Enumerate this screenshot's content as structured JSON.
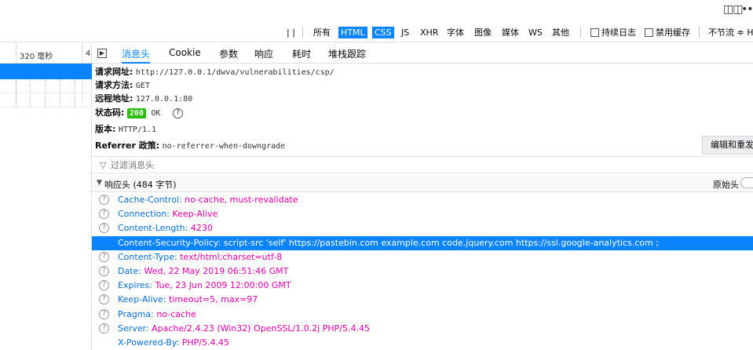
{
  "window": {
    "icon_glyph": "◫◫",
    "more_glyph": "••"
  },
  "filters": {
    "all": "所有",
    "html": "HTML",
    "css": "CSS",
    "js": "JS",
    "xhr": "XHR",
    "fonts": "字体",
    "images": "图像",
    "media": "媒体",
    "ws": "WS",
    "other": "其他"
  },
  "options": {
    "persist_logs": "持续日志",
    "disable_cache": "禁用缓存",
    "throttle": "不节流 ≑ H"
  },
  "timeline": {
    "ms_label": "320 毫秒",
    "ms_label2": "4"
  },
  "tabs": [
    "消息头",
    "Cookie",
    "参数",
    "响应",
    "耗时",
    "堆栈跟踪"
  ],
  "summary": {
    "url_label": "请求网址:",
    "url": "http://127.0.0.1/dwva/vulnerabilities/csp/",
    "method_label": "请求方法:",
    "method": "GET",
    "remote_label": "远程地址:",
    "remote": "127.0.0.1:80",
    "status_label": "状态码:",
    "status_code": "200",
    "status_text": "OK",
    "version_label": "版本:",
    "version": "HTTP/1.1",
    "referrer_label": "Referrer 政策:",
    "referrer": "no-referrer-when-downgrade"
  },
  "edit_button": "编辑和重发",
  "filter_placeholder": "过滤消息头",
  "response_headers": {
    "title": "响应头 (484 字节)",
    "raw_label": "原始头",
    "rows": [
      {
        "name": "Cache-Control:",
        "value": "no-cache, must-revalidate"
      },
      {
        "name": "Connection:",
        "value": "Keep-Alive"
      },
      {
        "name": "Content-Length:",
        "value": "4230"
      },
      {
        "name": "Content-Security-Policy:",
        "value": "script-src 'self' https://pastebin.com  example.com code.jquery.com https://ssl.google-analytics.com ;"
      },
      {
        "name": "Content-Type:",
        "value": "text/html;charset=utf-8"
      },
      {
        "name": "Date:",
        "value": "Wed, 22 May 2019 06:51:46 GMT"
      },
      {
        "name": "Expires:",
        "value": "Tue, 23 Jun 2009 12:00:00 GMT"
      },
      {
        "name": "Keep-Alive:",
        "value": "timeout=5, max=97"
      },
      {
        "name": "Pragma:",
        "value": "no-cache"
      },
      {
        "name": "Server:",
        "value": "Apache/2.4.23 (Win32) OpenSSL/1.0.2j PHP/5.4.45"
      },
      {
        "name": "X-Powered-By:",
        "value": "PHP/5.4.45"
      }
    ]
  },
  "colors": {
    "accent": "#0a84ff",
    "header_name": "#0a6dd0",
    "header_value": "#dd00a9",
    "status_ok": "#2cbb0f"
  }
}
